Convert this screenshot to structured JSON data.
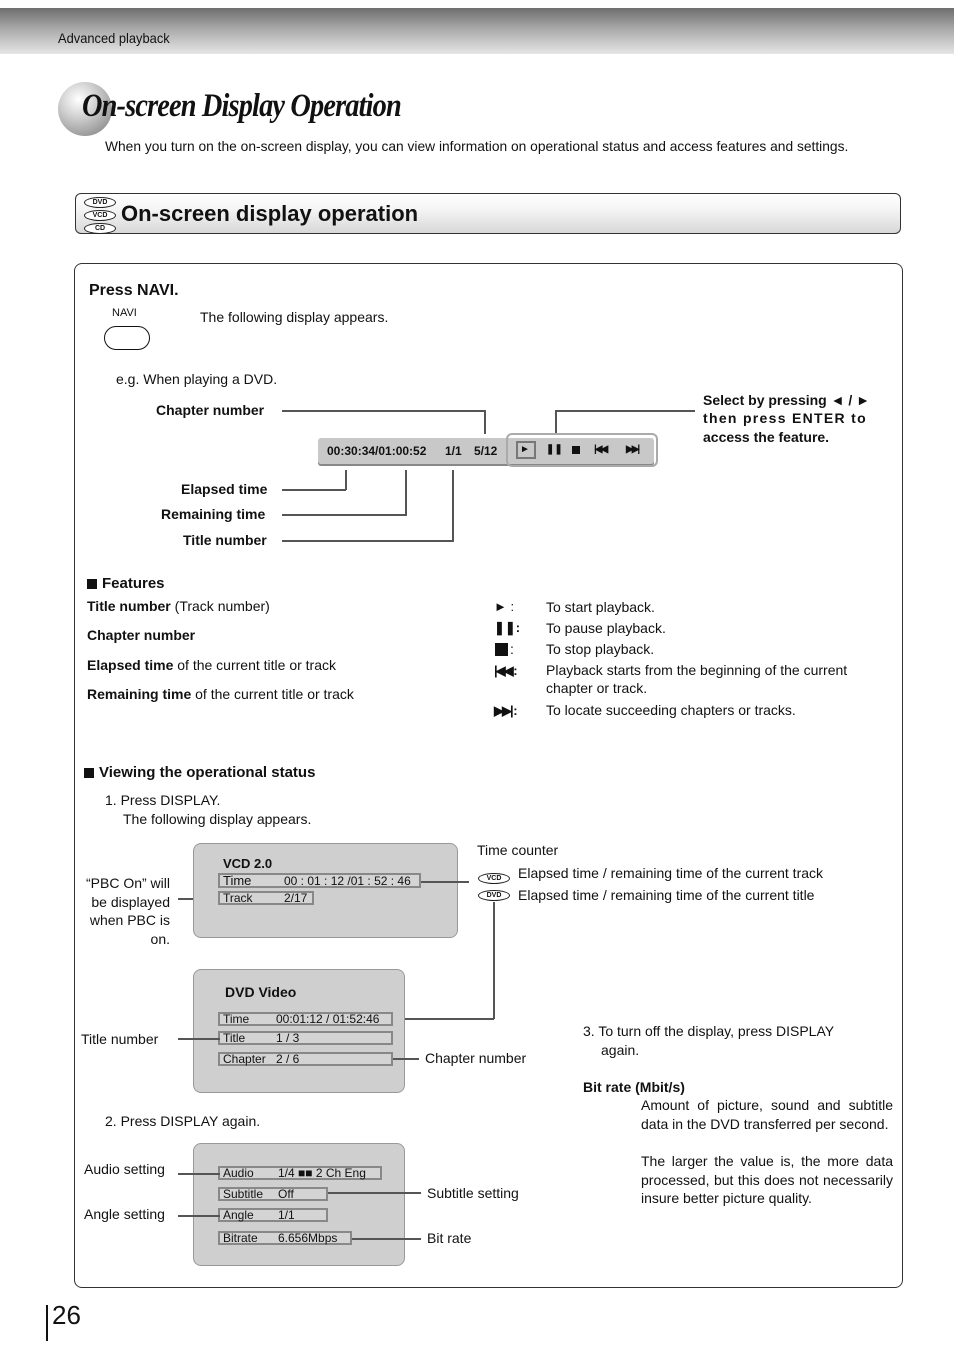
{
  "header": {
    "section_label": "Advanced playback"
  },
  "page": {
    "title": "On-screen Display Operation",
    "intro": "When you turn on the on-screen display, you can view information on operational status and access features and settings.",
    "page_number": "26"
  },
  "section": {
    "disc_badges": [
      "DVD",
      "VCD",
      "CD"
    ],
    "title": "On-screen display operation"
  },
  "navi": {
    "step_title": "Press NAVI.",
    "button_label": "NAVI",
    "description": "The following display appears.",
    "example": "e.g. When playing a DVD.",
    "osd": {
      "time": "00:30:34/01:00:52",
      "title": "1/1",
      "chapter": "5/12",
      "controls": [
        "play-icon",
        "pause-icon",
        "stop-icon",
        "skip-back-icon",
        "skip-forward-icon"
      ],
      "selected_control": "play-icon"
    },
    "callouts": {
      "chapter_number": "Chapter number",
      "elapsed_time": "Elapsed time",
      "remaining_time": "Remaining time",
      "title_number": "Title number",
      "select_line1": "Select by pressing ◄ / ►",
      "select_line2": "then press ENTER to",
      "select_line3": "access the feature."
    }
  },
  "features": {
    "heading": "Features",
    "items": [
      {
        "bold": "Title number",
        "rest": " (Track number)"
      },
      {
        "bold": "Chapter number",
        "rest": ""
      },
      {
        "bold": "Elapsed time",
        "rest": " of the current title or track"
      },
      {
        "bold": "Remaining time",
        "rest": " of the current title or track"
      }
    ],
    "controls": [
      {
        "icon": "play-icon",
        "desc": "To start playback."
      },
      {
        "icon": "pause-icon",
        "desc": "To pause playback."
      },
      {
        "icon": "stop-icon",
        "desc": "To stop playback."
      },
      {
        "icon": "skip-back-icon",
        "desc": "Playback starts from the beginning of the current",
        "desc2": "chapter or track."
      },
      {
        "icon": "skip-forward-icon",
        "desc": "To locate succeeding chapters or tracks."
      }
    ]
  },
  "status": {
    "heading": "Viewing the operational status",
    "step1": "1. Press DISPLAY.",
    "step1_sub": "The following display appears.",
    "pbc_note": [
      "“PBC On” will",
      "be displayed",
      "when PBC is",
      "on."
    ],
    "time_counter": {
      "label": "Time counter",
      "vcd_badge": "VCD",
      "vcd_desc": "Elapsed time / remaining time of the current track",
      "dvd_badge": "DVD",
      "dvd_desc": "Elapsed time / remaining time of the current title"
    },
    "vcd_panel": {
      "title": "VCD 2.0",
      "time_label": "Time",
      "time_value": "00 : 01 : 12 /01 : 52 : 46",
      "track_label": "Track",
      "track_value": "2/17"
    },
    "dvd_panel": {
      "title": "DVD Video",
      "time_label": "Time",
      "time_value": "00:01:12 / 01:52:46",
      "title_label": "Title",
      "title_value": "1 / 3",
      "chapter_label": "Chapter",
      "chapter_value": "2 / 6"
    },
    "title_number_label": "Title  number",
    "chapter_number_label": "Chapter number",
    "step2": "2. Press DISPLAY again.",
    "settings_panel": {
      "audio_label": "Audio",
      "audio_value": "1/4 ■■ 2 Ch  Eng",
      "subtitle_label": "Subtitle",
      "subtitle_value": "Off",
      "angle_label": "Angle",
      "angle_value": "1/1",
      "bitrate_label": "Bitrate",
      "bitrate_value": "6.656Mbps"
    },
    "callouts": {
      "audio": "Audio setting",
      "angle": "Angle setting",
      "subtitle": "Subtitle setting",
      "bitrate": "Bit rate"
    },
    "step3_line1": "3. To turn off the display, press DISPLAY",
    "step3_line2": "again.",
    "bitrate_heading": "Bit rate (Mbit/s)",
    "bitrate_para1": "Amount of picture, sound and subtitle data in the DVD transferred per second.",
    "bitrate_para2": "The larger the value is, the more data processed, but this does not necessarily insure better picture quality."
  }
}
